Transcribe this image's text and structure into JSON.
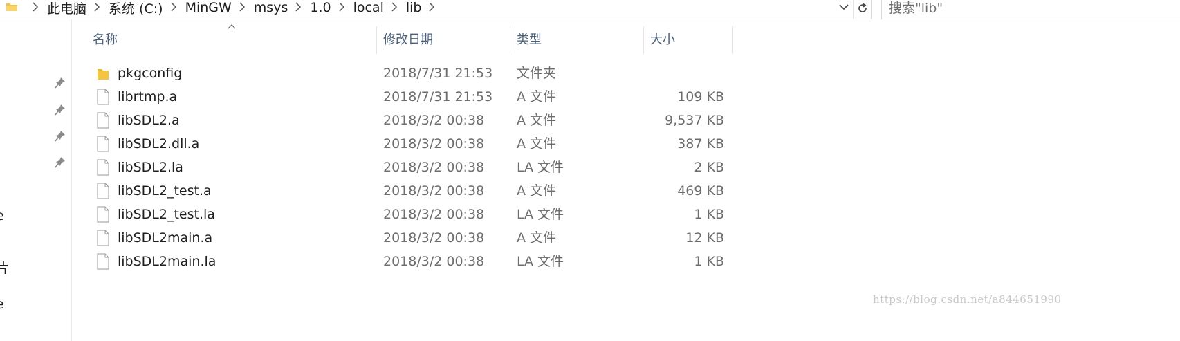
{
  "address_bar": {
    "breadcrumbs": [
      "此电脑",
      "系统 (C:)",
      "MinGW",
      "msys",
      "1.0",
      "local",
      "lib"
    ]
  },
  "search": {
    "placeholder": "搜索\"lib\""
  },
  "nav_pane": {
    "fragments": [
      "e",
      "片",
      "e"
    ]
  },
  "columns": {
    "name": "名称",
    "date": "修改日期",
    "type": "类型",
    "size": "大小"
  },
  "files": [
    {
      "name": "pkgconfig",
      "date": "2018/7/31 21:53",
      "type": "文件夹",
      "size": "",
      "icon": "folder-icon"
    },
    {
      "name": "librtmp.a",
      "date": "2018/7/31 21:53",
      "type": "A 文件",
      "size": "109 KB",
      "icon": "file-icon"
    },
    {
      "name": "libSDL2.a",
      "date": "2018/3/2 00:38",
      "type": "A 文件",
      "size": "9,537 KB",
      "icon": "file-icon"
    },
    {
      "name": "libSDL2.dll.a",
      "date": "2018/3/2 00:38",
      "type": "A 文件",
      "size": "387 KB",
      "icon": "file-icon"
    },
    {
      "name": "libSDL2.la",
      "date": "2018/3/2 00:38",
      "type": "LA 文件",
      "size": "2 KB",
      "icon": "file-icon"
    },
    {
      "name": "libSDL2_test.a",
      "date": "2018/3/2 00:38",
      "type": "A 文件",
      "size": "469 KB",
      "icon": "file-icon"
    },
    {
      "name": "libSDL2_test.la",
      "date": "2018/3/2 00:38",
      "type": "LA 文件",
      "size": "1 KB",
      "icon": "file-icon"
    },
    {
      "name": "libSDL2main.a",
      "date": "2018/3/2 00:38",
      "type": "A 文件",
      "size": "12 KB",
      "icon": "file-icon"
    },
    {
      "name": "libSDL2main.la",
      "date": "2018/3/2 00:38",
      "type": "LA 文件",
      "size": "1 KB",
      "icon": "file-icon"
    }
  ],
  "watermark": "https://blog.csdn.net/a844651990",
  "colors": {
    "folder": "#f5c542",
    "header_text": "#4c607a",
    "secondary_text": "#6d6d6d"
  }
}
